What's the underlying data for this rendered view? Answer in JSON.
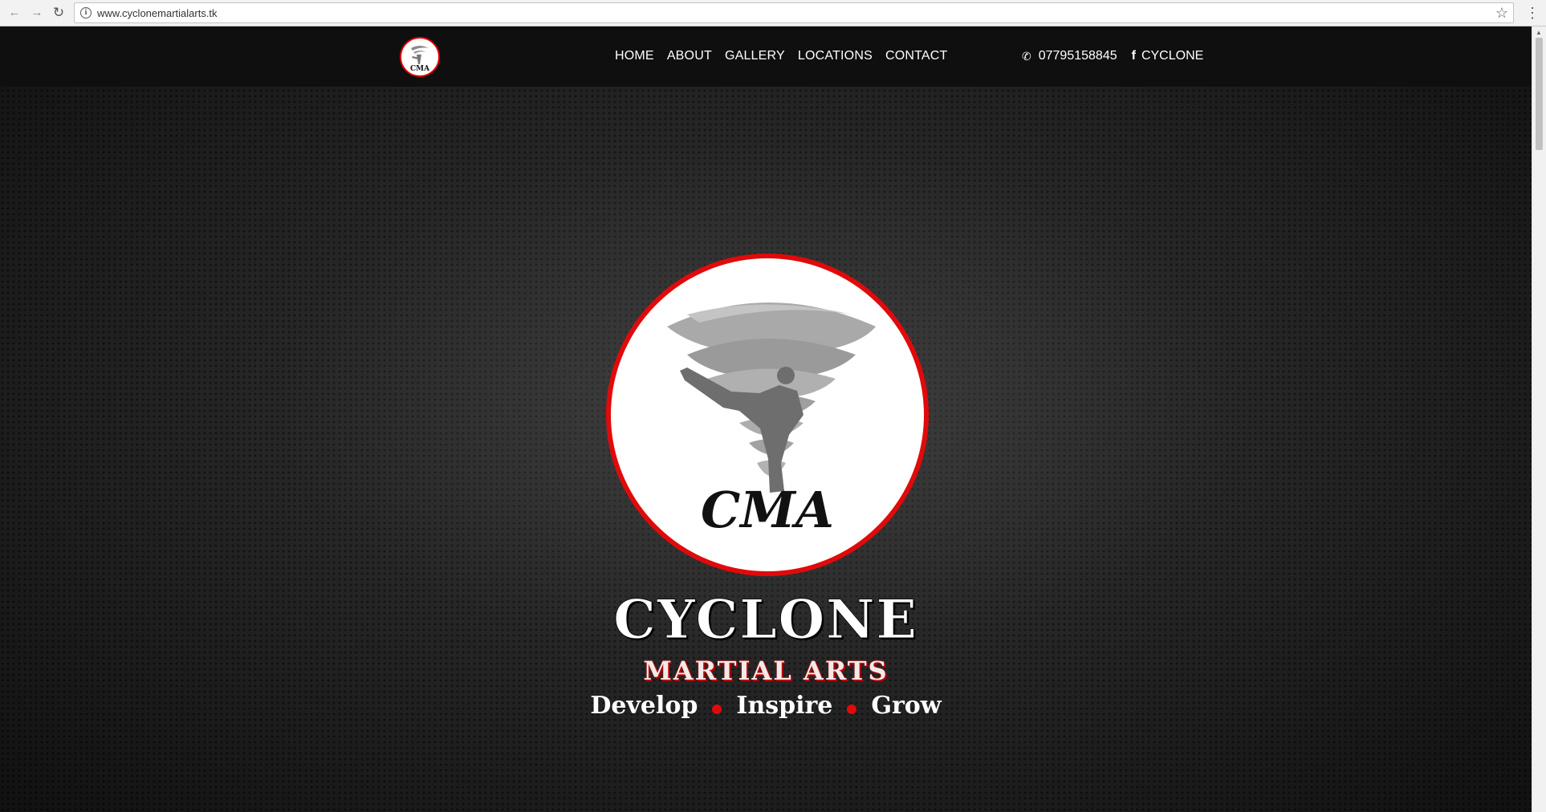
{
  "browser": {
    "url": "www.cyclonemartialarts.tk",
    "back_icon": "←",
    "forward_icon": "→",
    "reload_icon": "↻",
    "info_icon": "i",
    "star_icon": "☆",
    "menu_icon": "⋮"
  },
  "nav": {
    "logo_text": "CMA",
    "items": [
      {
        "label": "HOME"
      },
      {
        "label": "ABOUT"
      },
      {
        "label": "GALLERY"
      },
      {
        "label": "LOCATIONS"
      },
      {
        "label": "CONTACT"
      }
    ],
    "phone": "07795158845",
    "phone_icon": "✆",
    "facebook_icon": "f",
    "facebook_label": "CYCLONE"
  },
  "hero": {
    "logo_text": "CMA",
    "title": "CYCLONE",
    "subtitle": "MARTIAL ARTS",
    "tagline": [
      "Develop",
      "Inspire",
      "Grow"
    ]
  },
  "colors": {
    "accent": "#e10a0a",
    "background": "#262626",
    "nav_background": "#0f0f0f"
  }
}
